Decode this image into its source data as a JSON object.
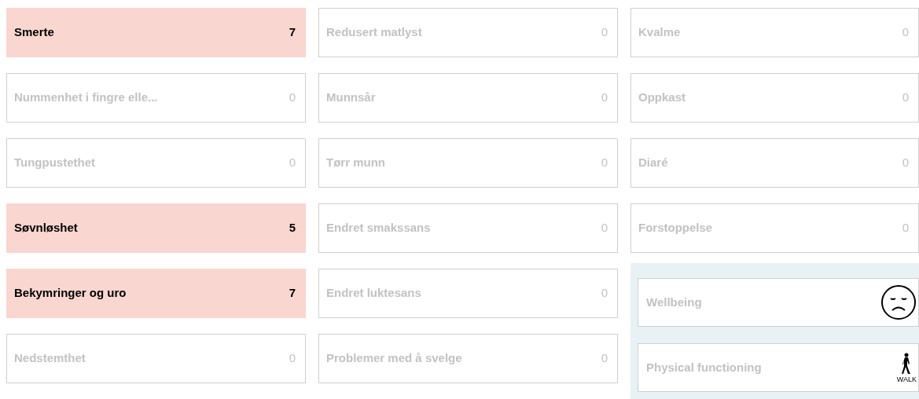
{
  "columns": [
    {
      "symptoms": [
        {
          "label": "Smerte",
          "score": "7",
          "active": true
        },
        {
          "label": "Nummenhet i fingre elle...",
          "score": "0",
          "active": false
        },
        {
          "label": "Tungpustethet",
          "score": "0",
          "active": false
        },
        {
          "label": "Søvnløshet",
          "score": "5",
          "active": true
        },
        {
          "label": "Bekymringer og uro",
          "score": "7",
          "active": true
        },
        {
          "label": "Nedstemthet",
          "score": "0",
          "active": false
        }
      ]
    },
    {
      "symptoms": [
        {
          "label": "Redusert matlyst",
          "score": "0",
          "active": false
        },
        {
          "label": "Munnsår",
          "score": "0",
          "active": false
        },
        {
          "label": "Tørr munn",
          "score": "0",
          "active": false
        },
        {
          "label": "Endret smakssans",
          "score": "0",
          "active": false
        },
        {
          "label": "Endret luktesans",
          "score": "0",
          "active": false
        },
        {
          "label": "Problemer med å svelge",
          "score": "0",
          "active": false
        }
      ]
    },
    {
      "symptoms": [
        {
          "label": "Kvalme",
          "score": "0",
          "active": false
        },
        {
          "label": "Oppkast",
          "score": "0",
          "active": false
        },
        {
          "label": "Diaré",
          "score": "0",
          "active": false
        },
        {
          "label": "Forstoppelse",
          "score": "0",
          "active": false
        }
      ]
    }
  ],
  "wellbeing_panel": {
    "items": [
      {
        "kind": "face",
        "label": "Wellbeing"
      },
      {
        "kind": "walk",
        "label": "Physical functioning",
        "icon_caption": "WALK"
      }
    ]
  }
}
